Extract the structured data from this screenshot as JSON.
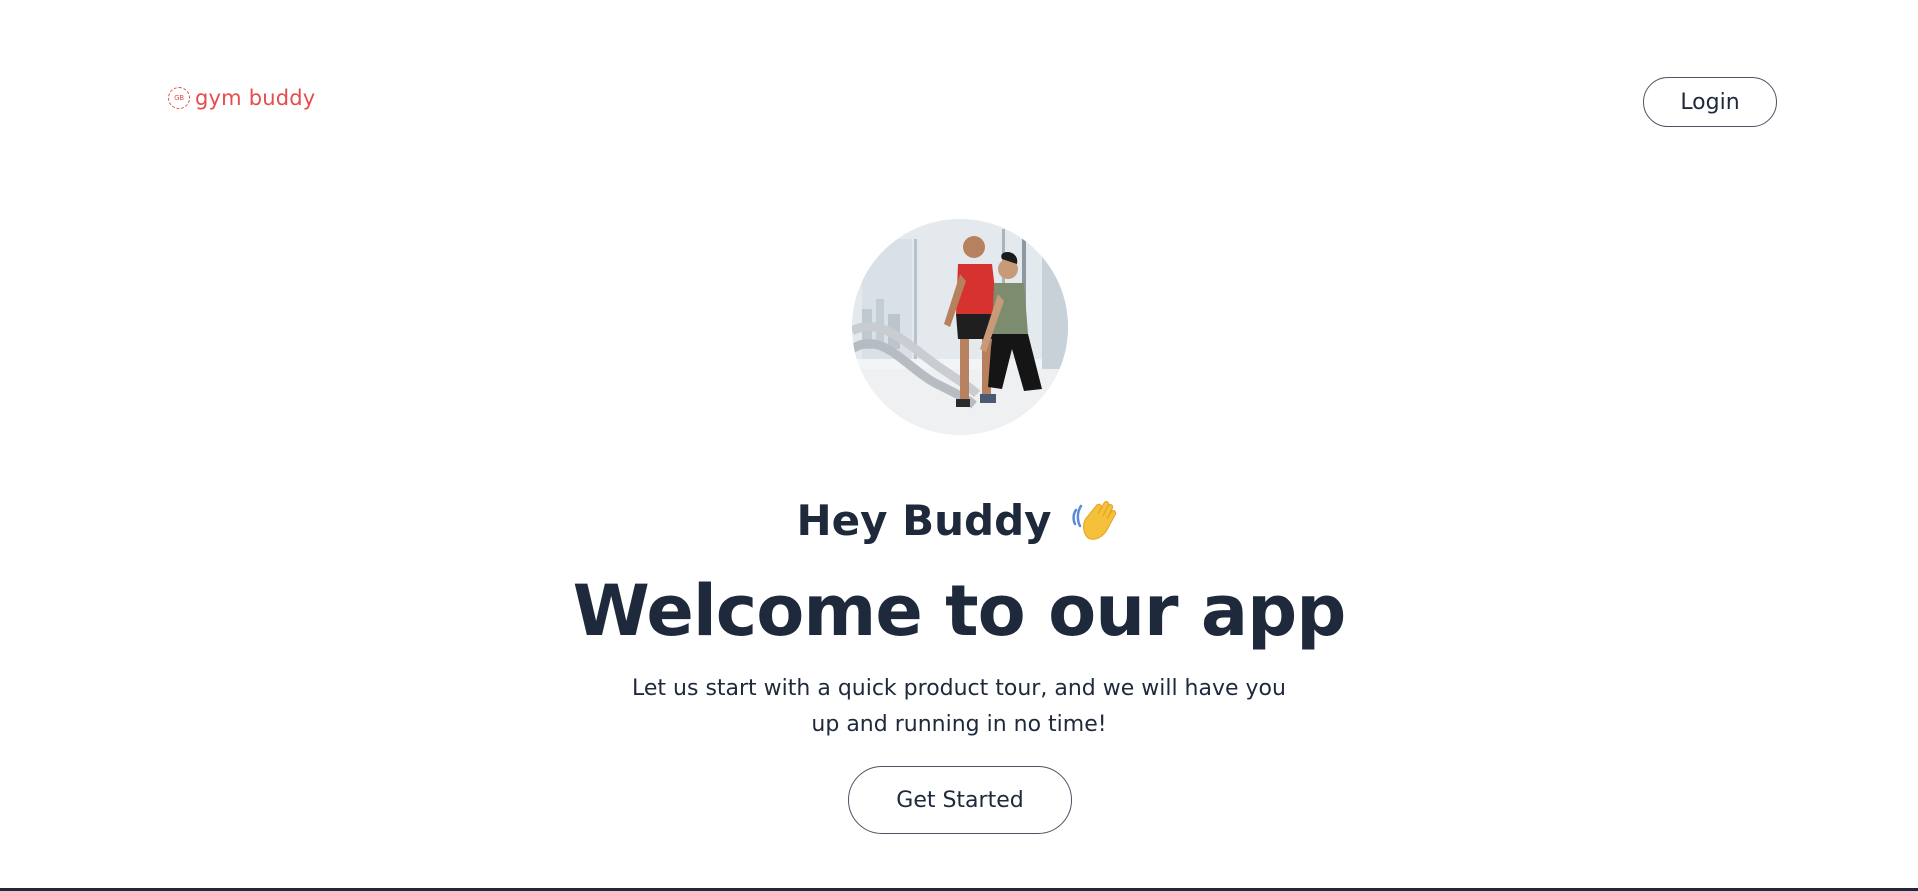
{
  "header": {
    "logo_mark": "GB",
    "logo_text": "gym buddy",
    "login_label": "Login"
  },
  "hero": {
    "image_alt": "two people training with battle ropes",
    "greeting": "Hey Buddy",
    "greeting_icon": "waving-hand-icon",
    "headline": "Welcome to our app",
    "subtext": "Let us start with a quick product tour, and we will have you up and running in no time!",
    "cta_label": "Get Started"
  },
  "colors": {
    "brand": "#e74c4c",
    "text": "#1e293b",
    "border": "#4b5563",
    "background": "#ffffff"
  }
}
